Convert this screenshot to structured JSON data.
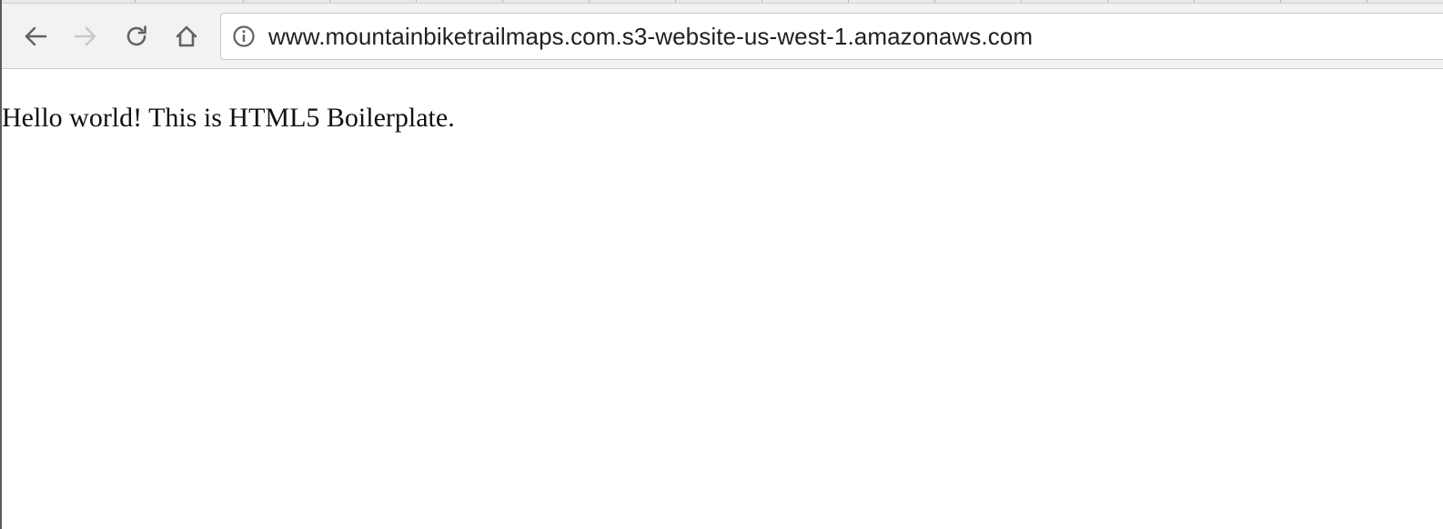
{
  "browser": {
    "address_bar": {
      "url": "www.mountainbiketrailmaps.com.s3-website-us-west-1.amazonaws.com",
      "security_icon": "info-icon"
    },
    "nav": {
      "back_icon": "back-arrow-icon",
      "forward_icon": "forward-arrow-icon",
      "forward_enabled": false,
      "reload_icon": "reload-icon",
      "home_icon": "home-icon"
    },
    "colors": {
      "icon_active": "#5f6368",
      "icon_disabled": "#c8c8c8",
      "toolbar_bg": "#f2f2f2"
    }
  },
  "page": {
    "body_text": "Hello world! This is HTML5 Boilerplate."
  }
}
